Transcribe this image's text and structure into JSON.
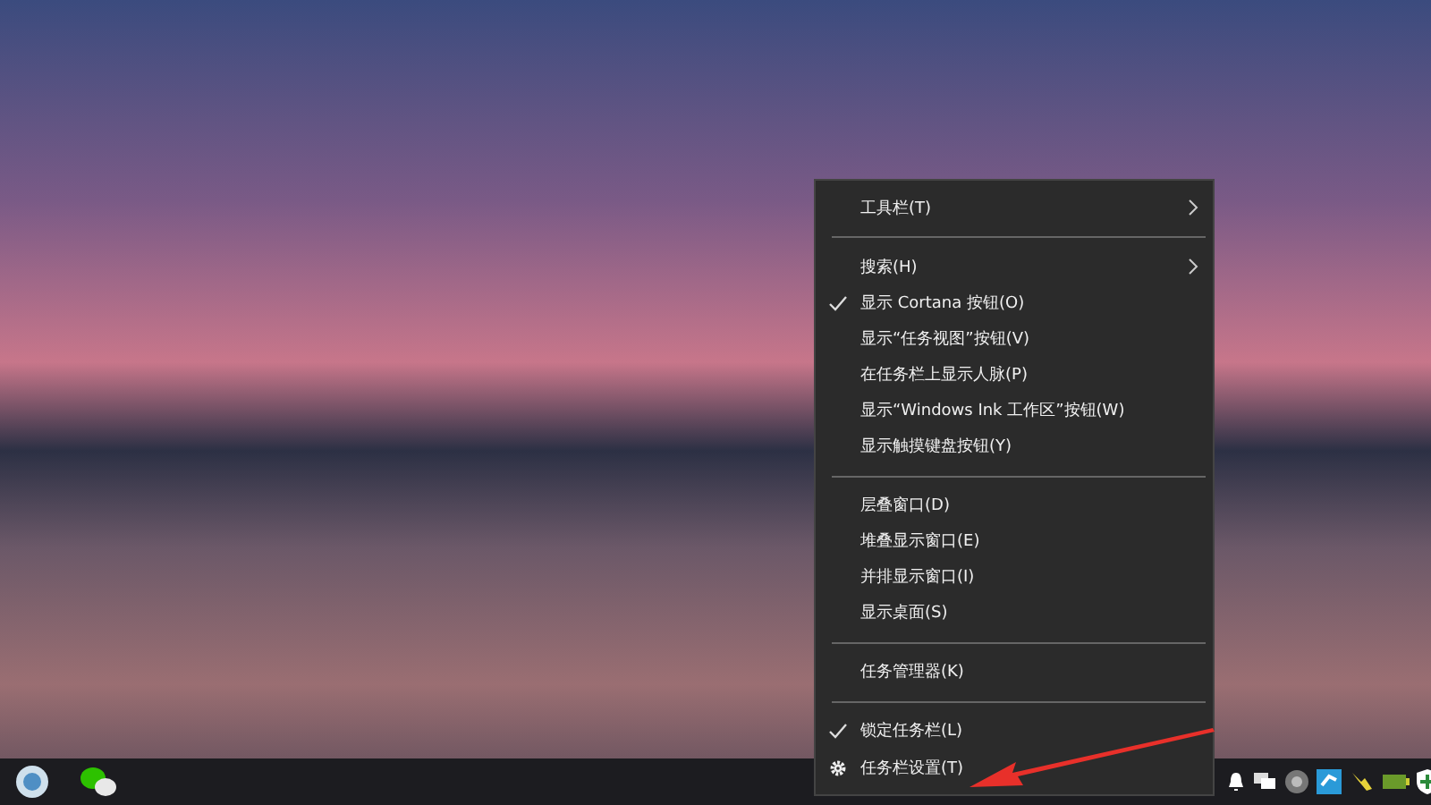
{
  "menu": {
    "items": [
      {
        "kind": "submenu",
        "label": "工具栏(T)",
        "checked": false
      },
      {
        "kind": "separator"
      },
      {
        "kind": "submenu",
        "label": "搜索(H)",
        "checked": false
      },
      {
        "kind": "item",
        "label": "显示 Cortana 按钮(O)",
        "checked": true
      },
      {
        "kind": "item",
        "label": "显示“任务视图”按钮(V)",
        "checked": false
      },
      {
        "kind": "item",
        "label": "在任务栏上显示人脉(P)",
        "checked": false
      },
      {
        "kind": "item",
        "label": "显示“Windows Ink 工作区”按钮(W)",
        "checked": false
      },
      {
        "kind": "item",
        "label": "显示触摸键盘按钮(Y)",
        "checked": false
      },
      {
        "kind": "separator"
      },
      {
        "kind": "item",
        "label": "层叠窗口(D)",
        "checked": false
      },
      {
        "kind": "item",
        "label": "堆叠显示窗口(E)",
        "checked": false
      },
      {
        "kind": "item",
        "label": "并排显示窗口(I)",
        "checked": false
      },
      {
        "kind": "item",
        "label": "显示桌面(S)",
        "checked": false
      },
      {
        "kind": "separator"
      },
      {
        "kind": "item",
        "label": "任务管理器(K)",
        "checked": false
      },
      {
        "kind": "separator"
      },
      {
        "kind": "item",
        "label": "锁定任务栏(L)",
        "checked": true
      },
      {
        "kind": "settings",
        "label": "任务栏设置(T)",
        "checked": false
      }
    ]
  }
}
